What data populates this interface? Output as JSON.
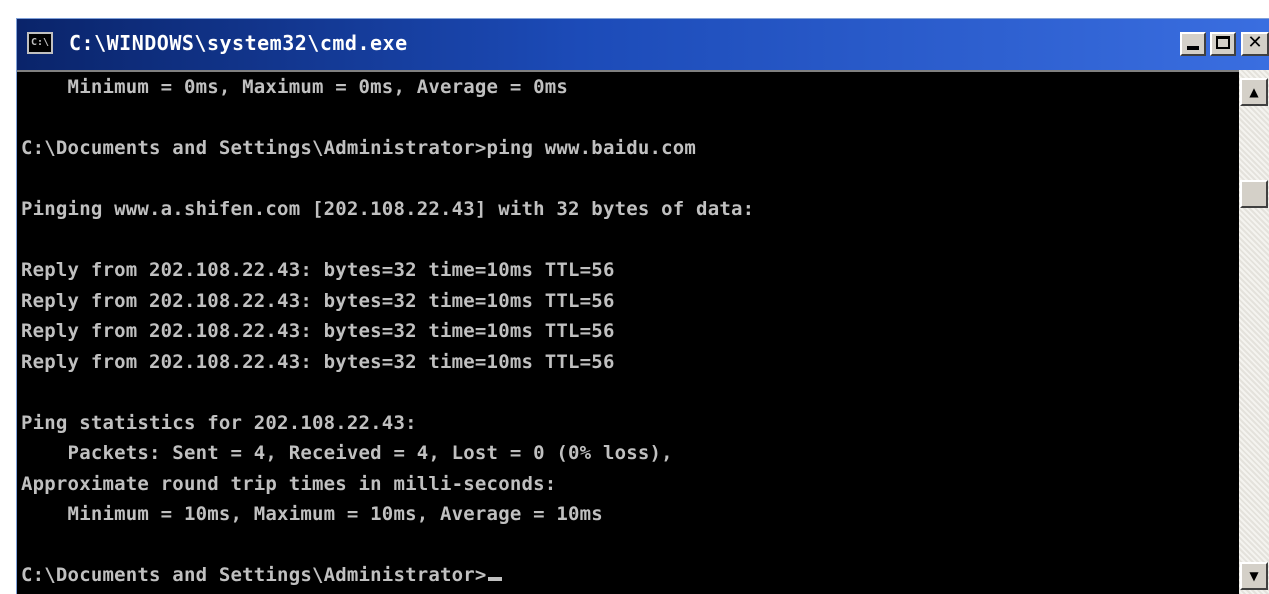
{
  "window": {
    "title": "C:\\WINDOWS\\system32\\cmd.exe",
    "icon_label": "C:\\",
    "controls": {
      "minimize": "minimize-icon",
      "maximize": "maximize-icon",
      "close": "close-icon",
      "close_glyph": "✕"
    }
  },
  "console": {
    "lines": [
      "    Minimum = 0ms, Maximum = 0ms, Average = 0ms",
      "",
      "C:\\Documents and Settings\\Administrator>ping www.baidu.com",
      "",
      "Pinging www.a.shifen.com [202.108.22.43] with 32 bytes of data:",
      "",
      "Reply from 202.108.22.43: bytes=32 time=10ms TTL=56",
      "Reply from 202.108.22.43: bytes=32 time=10ms TTL=56",
      "Reply from 202.108.22.43: bytes=32 time=10ms TTL=56",
      "Reply from 202.108.22.43: bytes=32 time=10ms TTL=56",
      "",
      "Ping statistics for 202.108.22.43:",
      "    Packets: Sent = 4, Received = 4, Lost = 0 (0% loss),",
      "Approximate round trip times in milli-seconds:",
      "    Minimum = 10ms, Maximum = 10ms, Average = 10ms",
      "",
      "C:\\Documents and Settings\\Administrator>"
    ]
  },
  "scrollbar": {
    "up_glyph": "▲",
    "down_glyph": "▼"
  },
  "colors": {
    "title_bar": "#0a246a",
    "console_bg": "#000000",
    "console_text": "#c0c0c0"
  }
}
